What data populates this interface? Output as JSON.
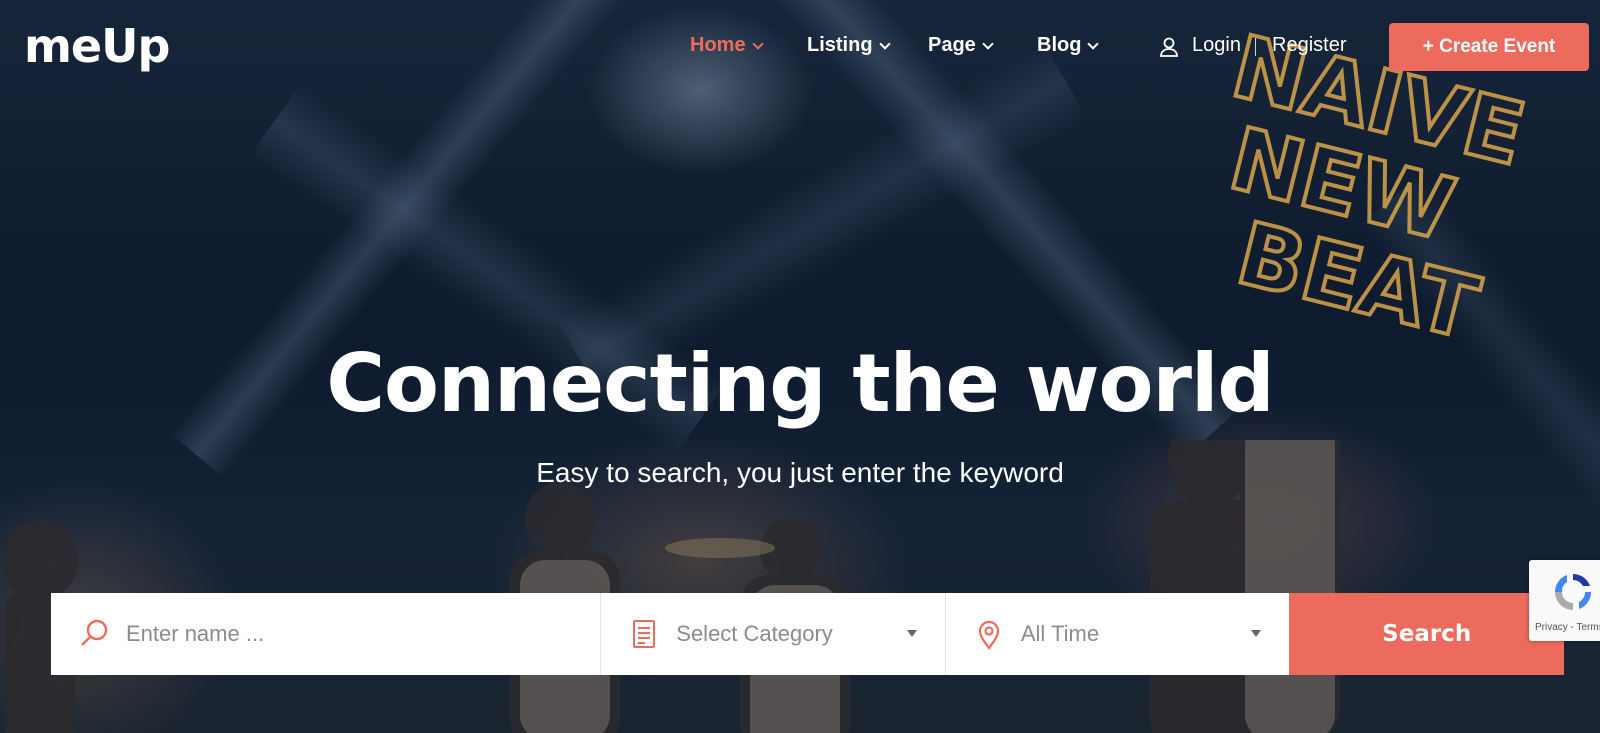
{
  "brand": {
    "logo_text": "meUp",
    "accent": "#ec6b5d"
  },
  "nav": {
    "items": [
      {
        "label": "Home",
        "active": true
      },
      {
        "label": "Listing",
        "active": false
      },
      {
        "label": "Page",
        "active": false
      },
      {
        "label": "Blog",
        "active": false
      }
    ],
    "login": "Login",
    "register": "Register",
    "create_event": "+ Create Event"
  },
  "hero": {
    "title": "Connecting the world",
    "subtitle": "Easy to search, you just enter the keyword",
    "sign_text": [
      "NAIVE",
      "NEW",
      "BEAT"
    ]
  },
  "search": {
    "name_placeholder": "Enter name ...",
    "category_value": "Select Category",
    "time_value": "All Time",
    "button_label": "Search"
  },
  "recaptcha": {
    "footer": "Privacy - Terms"
  },
  "icons": {
    "search": "search-icon",
    "category": "document-list-icon",
    "location": "map-pin-icon",
    "user": "user-icon"
  }
}
